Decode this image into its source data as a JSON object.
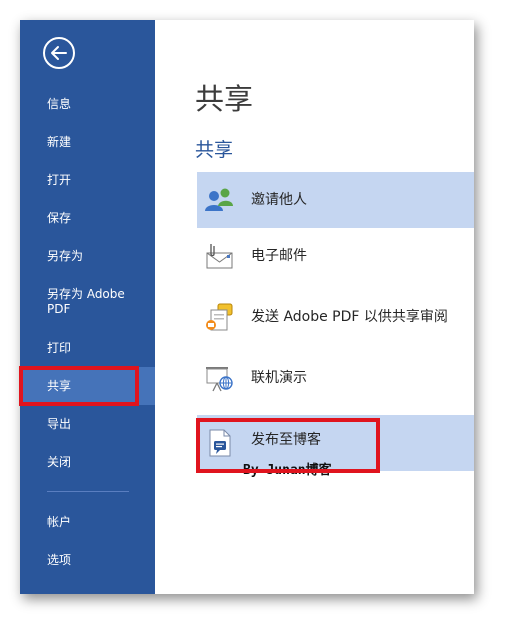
{
  "nav": {
    "items": [
      {
        "label": "信息"
      },
      {
        "label": "新建"
      },
      {
        "label": "打开"
      },
      {
        "label": "保存"
      },
      {
        "label": "另存为"
      },
      {
        "label": "另存为 Adobe PDF"
      },
      {
        "label": "打印"
      },
      {
        "label": "共享",
        "active": true
      },
      {
        "label": "导出"
      },
      {
        "label": "关闭"
      }
    ],
    "bottom_items": [
      {
        "label": "帐户"
      },
      {
        "label": "选项"
      }
    ]
  },
  "main": {
    "title": "共享",
    "section_title": "共享",
    "share_options": [
      {
        "label": "邀请他人",
        "icon": "people-icon",
        "selected": true
      },
      {
        "label": "电子邮件",
        "icon": "email-icon"
      },
      {
        "label": "发送 Adobe PDF 以供共享审阅",
        "icon": "pdf-review-icon"
      },
      {
        "label": "联机演示",
        "icon": "present-online-icon"
      },
      {
        "label": "发布至博客",
        "icon": "blog-icon",
        "selected": true
      }
    ]
  },
  "watermark": "By Junan博客",
  "colors": {
    "sidebar": "#2a569b",
    "sidebar_active": "#4573b9",
    "selected_item": "#c5d6f1",
    "highlight": "#e0141e"
  }
}
